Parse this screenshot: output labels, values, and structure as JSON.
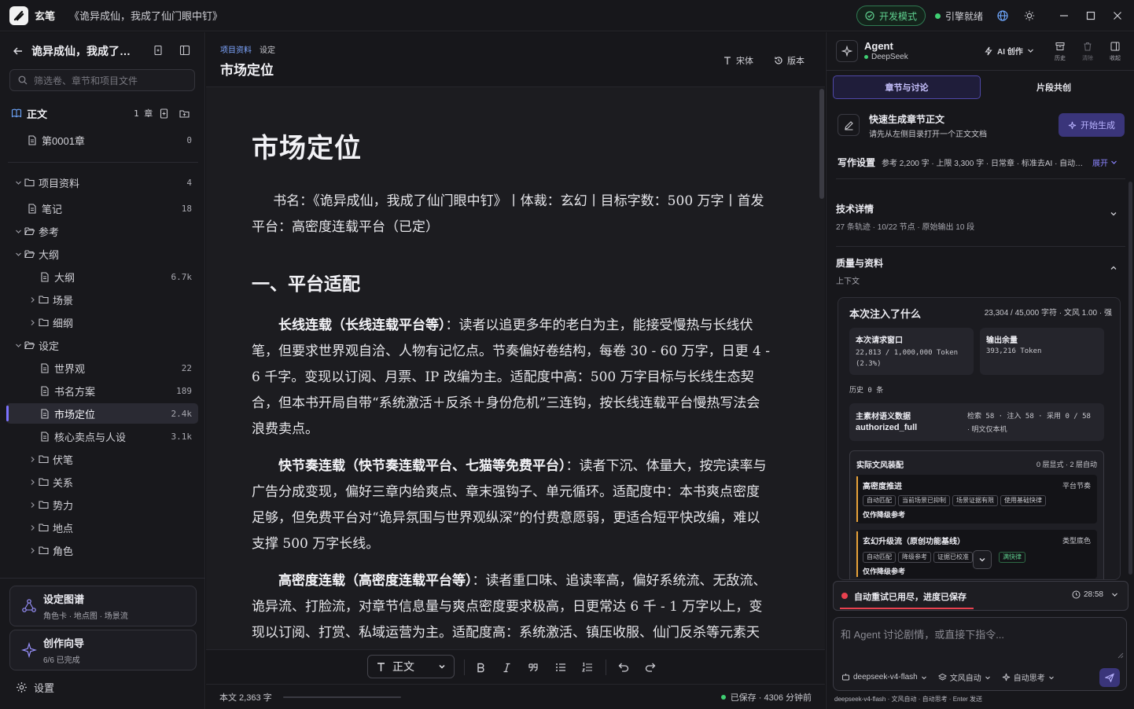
{
  "titlebar": {
    "app_name": "玄笔",
    "doc_title": "《诡异成仙，我成了仙门眼中钉》",
    "dev_mode": "开发模式",
    "engine_status": "引擎就绪"
  },
  "sidebar": {
    "book_title": "诡异成仙，我成了…",
    "search_placeholder": "筛选卷、章节和项目文件",
    "main_label": "正文",
    "main_count": "1 章",
    "tree": [
      {
        "label": "第0001章",
        "count": "0",
        "level": 1,
        "type": "file",
        "chev": ""
      },
      {
        "label": "项目资料",
        "count": "4",
        "level": 0,
        "type": "folder",
        "chev": "down"
      },
      {
        "label": "笔记",
        "count": "18",
        "level": 1,
        "type": "file",
        "chev": ""
      },
      {
        "label": "参考",
        "count": "",
        "level": 0,
        "type": "folder-open",
        "chev": "down"
      },
      {
        "label": "大纲",
        "count": "",
        "level": 0,
        "type": "folder-open",
        "chev": "down"
      },
      {
        "label": "大纲",
        "count": "6.7k",
        "level": 2,
        "type": "file",
        "chev": ""
      },
      {
        "label": "场景",
        "count": "",
        "level": 1,
        "type": "folder",
        "chev": "right"
      },
      {
        "label": "细纲",
        "count": "",
        "level": 1,
        "type": "folder",
        "chev": "right"
      },
      {
        "label": "设定",
        "count": "",
        "level": 0,
        "type": "folder-open",
        "chev": "down"
      },
      {
        "label": "世界观",
        "count": "22",
        "level": 2,
        "type": "file",
        "chev": ""
      },
      {
        "label": "书名方案",
        "count": "189",
        "level": 2,
        "type": "file",
        "chev": ""
      },
      {
        "label": "市场定位",
        "count": "2.4k",
        "level": 2,
        "type": "file",
        "chev": "",
        "active": true
      },
      {
        "label": "核心卖点与人设",
        "count": "3.1k",
        "level": 2,
        "type": "file",
        "chev": ""
      },
      {
        "label": "伏笔",
        "count": "",
        "level": 1,
        "type": "folder",
        "chev": "right"
      },
      {
        "label": "关系",
        "count": "",
        "level": 1,
        "type": "folder",
        "chev": "right"
      },
      {
        "label": "势力",
        "count": "",
        "level": 1,
        "type": "folder",
        "chev": "right"
      },
      {
        "label": "地点",
        "count": "",
        "level": 1,
        "type": "folder",
        "chev": "right"
      },
      {
        "label": "角色",
        "count": "",
        "level": 1,
        "type": "folder",
        "chev": "right"
      }
    ],
    "card1": {
      "title": "设定图谱",
      "sub": "角色卡 · 地点图 · 场景流"
    },
    "card2": {
      "title": "创作向导",
      "sub": "6/6 已完成"
    },
    "settings": "设置"
  },
  "editor": {
    "breadcrumb1": "项目资料",
    "breadcrumb2": "设定",
    "title": "市场定位",
    "font_btn": "宋体",
    "version_btn": "版本",
    "doc_title": "市场定位",
    "intro": "书名：《诡异成仙，我成了仙门眼中钉》丨体裁：玄幻丨目标字数：500 万字丨首发平台：高密度连载平台（已定）",
    "h2": "一、平台适配",
    "p1_bold": "长线连载（长线连载平台等）",
    "p1": "：读者以追更多年的老白为主，能接受慢热与长线伏笔，但要求世界观自洽、人物有记忆点。节奏偏好卷结构，每卷 30 - 60 万字，日更 4 - 6 千字。变现以订阅、月票、IP 改编为主。适配度中高：500 万字目标与长线生态契合，但本书开局自带“系统激活＋反杀＋身份危机”三连钩，按长线连载平台慢热写法会浪费卖点。",
    "p2_bold": "快节奏连载（快节奏连载平台、七猫等免费平台）",
    "p2": "：读者下沉、体量大，按完读率与广告分成变现，偏好三章内给爽点、章末强钩子、单元循环。适配度中：本书爽点密度足够，但免费平台对“诡异氛围与世界观纵深”的付费意愿弱，更适合短平快改编，难以支撑 500 万字长线。",
    "p3_bold": "高密度连载（高密度连载平台等）",
    "p3": "：读者重口味、追读率高，偏好系统流、无敌流、诡异流、打脸流，对章节信息量与爽点密度要求极高，日更常达 6 千 - 1 万字以上，变现以订阅、打赏、私域运营为主。适配度高：系统激活、镇压收服、仙门反杀等元素天然契合。"
  },
  "toolbar": {
    "format_label": "正文"
  },
  "status": {
    "word_count": "本文 2,363 字",
    "saved": "已保存 · 4306 分钟前"
  },
  "agent": {
    "name": "Agent",
    "model": "DeepSeek",
    "ai_create": "AI 创作",
    "btn_history": "历史",
    "btn_clear": "清除",
    "btn_collapse": "收起",
    "tab1": "章节与讨论",
    "tab2": "片段共创",
    "gen_title": "快速生成章节正文",
    "gen_sub": "请先从左侧目录打开一个正文文档",
    "gen_btn": "开始生成",
    "write_label": "写作设置",
    "write_detail": "参考 2,200 字 · 上限 3,300 字 · 日常章 · 标准去AI · 自动…",
    "expand": "展开",
    "tech_title": "技术详情",
    "tech_sub": "27 条轨迹 · 10/22 节点 · 原始输出 10 段",
    "quality_title": "质量与资料",
    "quality_sub": "上下文",
    "inject_title": "本次注入了什么",
    "inject_stats": "23,304 / 45,000 字符 · 文风 1.00 · 强",
    "req_title": "本次请求窗口",
    "req_val": "22,813 / 1,000,000 Token (2.3%)",
    "left_title": "输出余量",
    "left_val": "393,216 Token",
    "history": "历史 0 条",
    "corpus_title": "主素材语义数据",
    "corpus_name": "authorized_full",
    "corpus_stats": "检索 58 · 注入 58 · 采用 0 / 58",
    "corpus_sub": "· 明文仅本机",
    "style_title": "实际文风装配",
    "style_stats": "0 层显式 · 2 层自动",
    "style1_name": "高密度推进",
    "style1_tag": "平台节奏",
    "style1_tags": [
      "自动匹配",
      "当前场景已抑制",
      "场景证据有限",
      "使用基础快律"
    ],
    "style1_note": "仅作降级参考",
    "style2_name": "玄幻升级流（原创功能基线）",
    "style2_tag": "类型底色",
    "style2_tags": [
      "自动匹配",
      "降级参考",
      "证据已校准"
    ],
    "style2_green": "满快律",
    "style2_note": "仅作降级参考",
    "autosave_text": "自动重试已用尽，进度已保存",
    "autosave_time": "28:58",
    "input_placeholder": "和 Agent 讨论剧情，或直接下指令...",
    "opt_model": "deepseek-v4-flash",
    "opt_style": "文风自动",
    "opt_think": "自动思考",
    "footer": "deepseek-v4-flash · 文风自动 · 自动思考 · Enter 发送"
  }
}
